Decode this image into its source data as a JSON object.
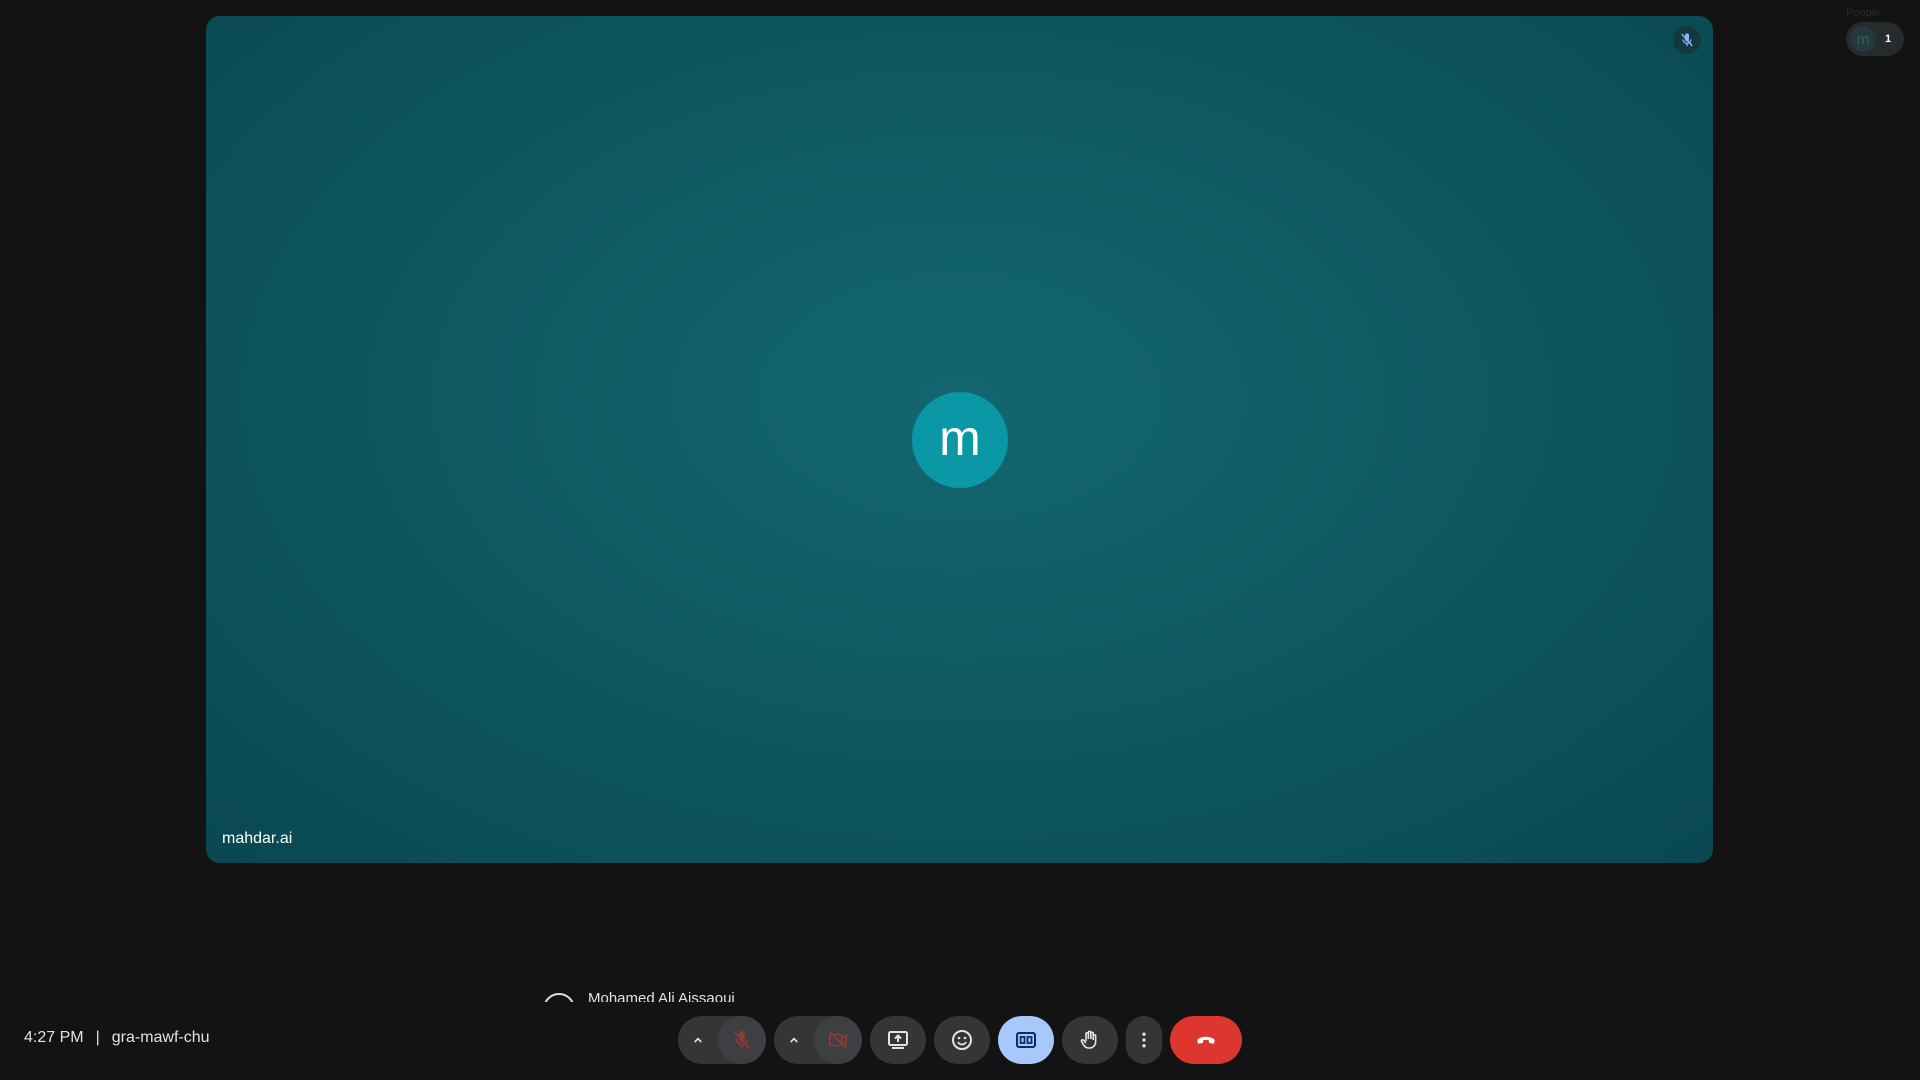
{
  "tile": {
    "participant_name": "mahdar.ai",
    "avatar_initial": "m",
    "mic_state": "muted"
  },
  "people": {
    "label": "People",
    "avatar_initial": "m",
    "count": "1"
  },
  "presenter": {
    "name": "Mohamed Ali Aissaoui"
  },
  "meeting": {
    "time": "4:27 PM",
    "separator": "|",
    "code": "gra-mawf-chu"
  },
  "controls": {
    "mic": "muted",
    "camera": "off",
    "captions": "on",
    "end_call_color": "#dc362e",
    "captions_color": "#a8c7fa"
  },
  "icons": [
    "mic-off-icon",
    "chevron-up-icon",
    "videocam-off-icon",
    "present-screen-icon",
    "emoji-icon",
    "captions-icon",
    "raise-hand-icon",
    "more-vert-icon",
    "call-end-icon"
  ]
}
